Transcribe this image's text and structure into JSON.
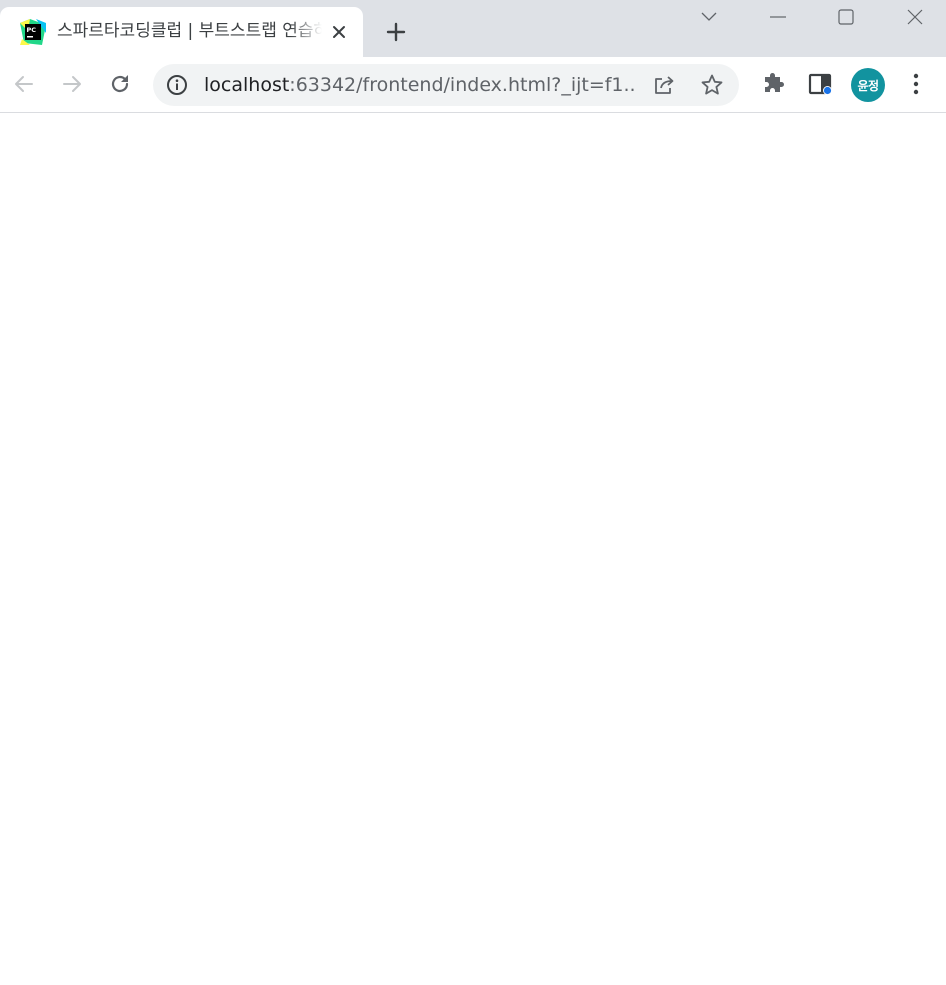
{
  "tab": {
    "title": "스파르타코딩클럽 | 부트스트랩 연습하기",
    "favicon": "pycharm-icon"
  },
  "toolbar": {
    "url_host": "localhost",
    "url_rest": ":63342/frontend/index.html?_ijt=f1...",
    "avatar_label": "윤정"
  },
  "colors": {
    "tabstrip": "#dee1e6",
    "omnibox": "#f1f3f4",
    "avatar": "#12939f",
    "icon": "#5f6368",
    "icon_disabled": "#c4c7c9",
    "notification_dot": "#1a73e8"
  }
}
